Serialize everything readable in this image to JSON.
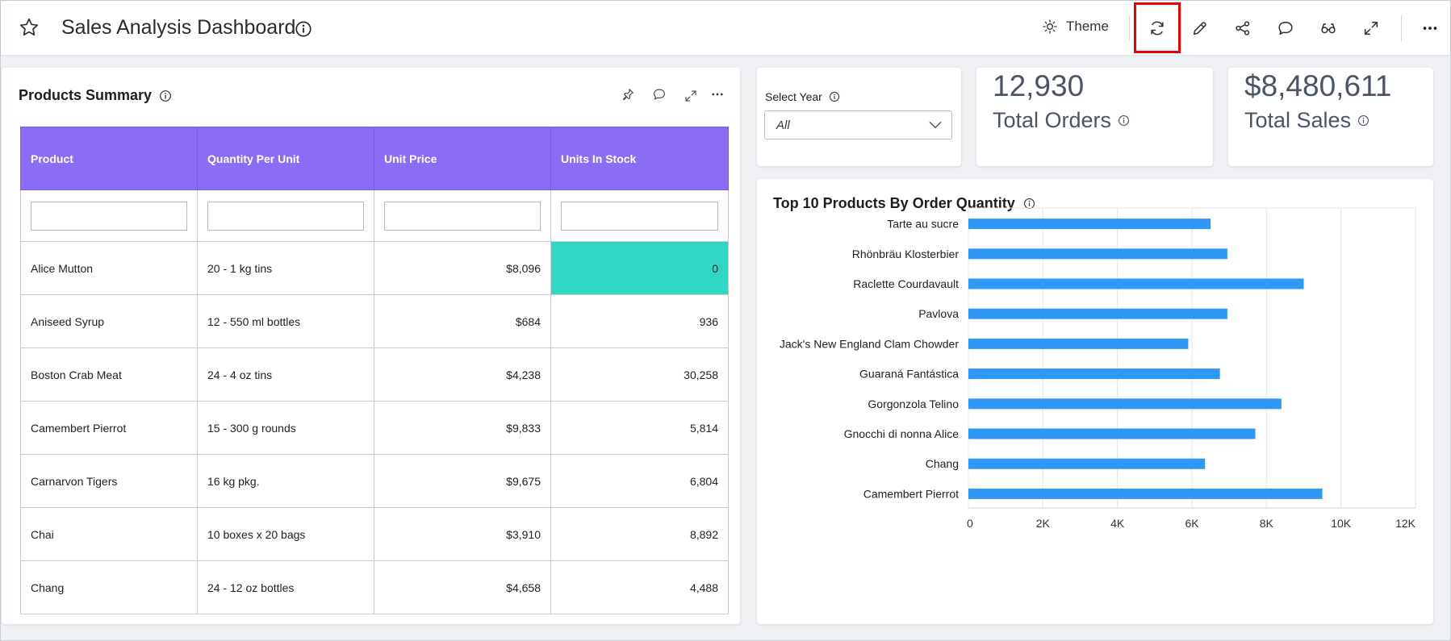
{
  "header": {
    "title": "Sales Analysis Dashboard",
    "theme_label": "Theme",
    "icons": [
      "star-icon",
      "info-icon",
      "sun-icon",
      "refresh-icon",
      "pencil-icon",
      "share-icon",
      "comment-icon",
      "glasses-icon",
      "expand-icon",
      "more-icon"
    ]
  },
  "products": {
    "title": "Products Summary",
    "columns": [
      "Product",
      "Quantity Per Unit",
      "Unit Price",
      "Units In Stock"
    ],
    "rows": [
      [
        "Alice Mutton",
        "20 - 1 kg tins",
        "$8,096",
        "0"
      ],
      [
        "Aniseed Syrup",
        "12 - 550 ml bottles",
        "$684",
        "936"
      ],
      [
        "Boston Crab Meat",
        "24 - 4 oz tins",
        "$4,238",
        "30,258"
      ],
      [
        "Camembert Pierrot",
        "15 - 300 g rounds",
        "$9,833",
        "5,814"
      ],
      [
        "Carnarvon Tigers",
        "16 kg pkg.",
        "$9,675",
        "6,804"
      ],
      [
        "Chai",
        "10 boxes x 20 bags",
        "$3,910",
        "8,892"
      ],
      [
        "Chang",
        "24 - 12 oz bottles",
        "$4,658",
        "4,488"
      ]
    ],
    "highlight_color": "#2ed8c5",
    "header_color": "#8b6cf5"
  },
  "year_filter": {
    "label": "Select Year",
    "value": "All"
  },
  "kpis": {
    "orders": {
      "value": "12,930",
      "label": "Total Orders"
    },
    "sales": {
      "value": "$8,480,611",
      "label": "Total Sales"
    }
  },
  "chart_data": {
    "type": "bar",
    "orientation": "horizontal",
    "title": "Top 10 Products By Order Quantity",
    "categories": [
      "Tarte au sucre",
      "Rhönbräu Klosterbier",
      "Raclette Courdavault",
      "Pavlova",
      "Jack's New England Clam Chowder",
      "Guaraná Fantástica",
      "Gorgonzola Telino",
      "Gnocchi di nonna Alice",
      "Chang",
      "Camembert Pierrot"
    ],
    "values": [
      6500,
      6950,
      9000,
      6950,
      5900,
      6750,
      8400,
      7700,
      6350,
      9500
    ],
    "xlim": [
      0,
      12000
    ],
    "xticks": [
      "0",
      "2K",
      "4K",
      "6K",
      "8K",
      "10K",
      "12K"
    ],
    "grid": true,
    "bar_color": "#2f97f5"
  }
}
